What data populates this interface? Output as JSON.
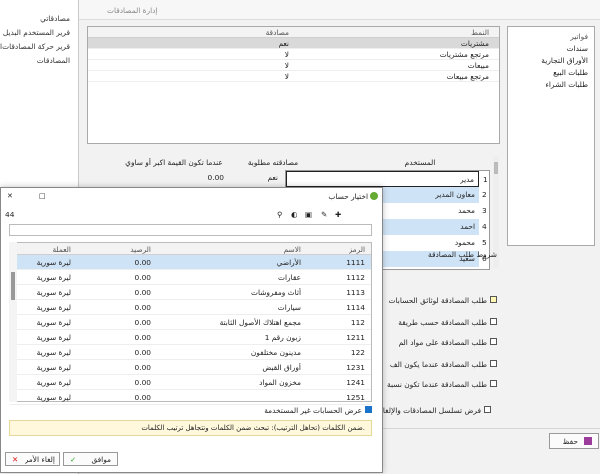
{
  "background_menu": {
    "items": [
      "مصادقاتي",
      "قرير المستخدم البديل",
      "قرير حركة المصادقات",
      "المصادقات"
    ],
    "side_char": "ا"
  },
  "main_window": {
    "title": "إدارة المصادقات"
  },
  "top_grid": {
    "headers": [
      "النمط",
      "مصادقة"
    ],
    "rows": [
      [
        "مشتريات",
        "نعم"
      ],
      [
        "مرتجع مشتريات",
        "لا"
      ],
      [
        "مبيعات",
        "لا"
      ],
      [
        "مرتجع مبيعات",
        "لا"
      ]
    ]
  },
  "right_list": {
    "items": [
      "فواتير",
      "سندات",
      "الأوراق التجارية",
      "طلبات البيع",
      "طلبات الشراء"
    ]
  },
  "users_grid": {
    "headers": [
      "المستخدم",
      "مصادقته مطلوبة",
      "عندما تكون القيمة اكبر أو ساوي"
    ],
    "rows": [
      {
        "n": "1",
        "user": "مدير",
        "req": "نعم",
        "val": "0.00"
      },
      {
        "n": "2",
        "user": "معاون المدير",
        "req": "",
        "val": ""
      },
      {
        "n": "3",
        "user": "محمد",
        "req": "",
        "val": ""
      },
      {
        "n": "4",
        "user": "احمد",
        "req": "",
        "val": ""
      },
      {
        "n": "5",
        "user": "محمود",
        "req": "",
        "val": ""
      },
      {
        "n": "6",
        "user": "سعيد",
        "req": "",
        "val": ""
      }
    ]
  },
  "conditions": {
    "title": "شروط طلب المصادقة",
    "items": [
      {
        "label": "طلب المصادقة لوثائق الحسابات",
        "checked": true
      },
      {
        "label": "طلب المصادقة حسب طريقة",
        "checked": false
      },
      {
        "label": "طلب المصادقة على مواد الم",
        "checked": false
      },
      {
        "label": "طلب المصادقة عندما يكون الف",
        "checked": false
      },
      {
        "label": "طلب المصادقة عندما تكون نسبة",
        "checked": false
      }
    ],
    "sequence_label": "فرض تسلسل المصادقات والإلغاء",
    "sequence_checked": false
  },
  "save_button": {
    "label": "حفظ"
  },
  "dialog": {
    "title": "اختيار حساب",
    "count": "44",
    "search_value": "",
    "columns": [
      "الرمز",
      "الاسم",
      "الرصيد",
      "العملة"
    ],
    "rows": [
      {
        "code": "1111",
        "name": "الأراضي",
        "bal": "0.00",
        "cur": "ليرة سورية"
      },
      {
        "code": "1112",
        "name": "عقارات",
        "bal": "0.00",
        "cur": "ليرة سورية"
      },
      {
        "code": "1113",
        "name": "أثاث ومفروشات",
        "bal": "0.00",
        "cur": "ليرة سورية"
      },
      {
        "code": "1114",
        "name": "سيارات",
        "bal": "0.00",
        "cur": "ليرة سورية"
      },
      {
        "code": "112",
        "name": "مجمع اهتلاك الأصول الثابتة",
        "bal": "0.00",
        "cur": "ليرة سورية"
      },
      {
        "code": "1211",
        "name": "زبون رقم 1",
        "bal": "0.00",
        "cur": "ليرة سورية"
      },
      {
        "code": "122",
        "name": "مدينون مختلفون",
        "bal": "0.00",
        "cur": "ليرة سورية"
      },
      {
        "code": "1231",
        "name": "أوراق القبض",
        "bal": "0.00",
        "cur": "ليرة سورية"
      },
      {
        "code": "1241",
        "name": "مخزون المواد",
        "bal": "0.00",
        "cur": "ليرة سورية"
      },
      {
        "code": "1251",
        "name": "",
        "bal": "0.00",
        "cur": "ليرة سورية"
      }
    ],
    "show_unused_label": "عرض الحسابات غير المستخدمة",
    "show_unused_checked": true,
    "hint": "ضمن الكلمات (تحاهل الترتيب): تبحث ضمن الكلمات وتتجاهل ترتيب الكلمات.",
    "ok_label": "موافق",
    "cancel_label": "إلغاء الأمر"
  },
  "colors": {
    "selection": "#cfe3f6",
    "highlight": "#dbe8f5",
    "hint_bg": "#fff8dc",
    "accent": "#1a73c9"
  }
}
